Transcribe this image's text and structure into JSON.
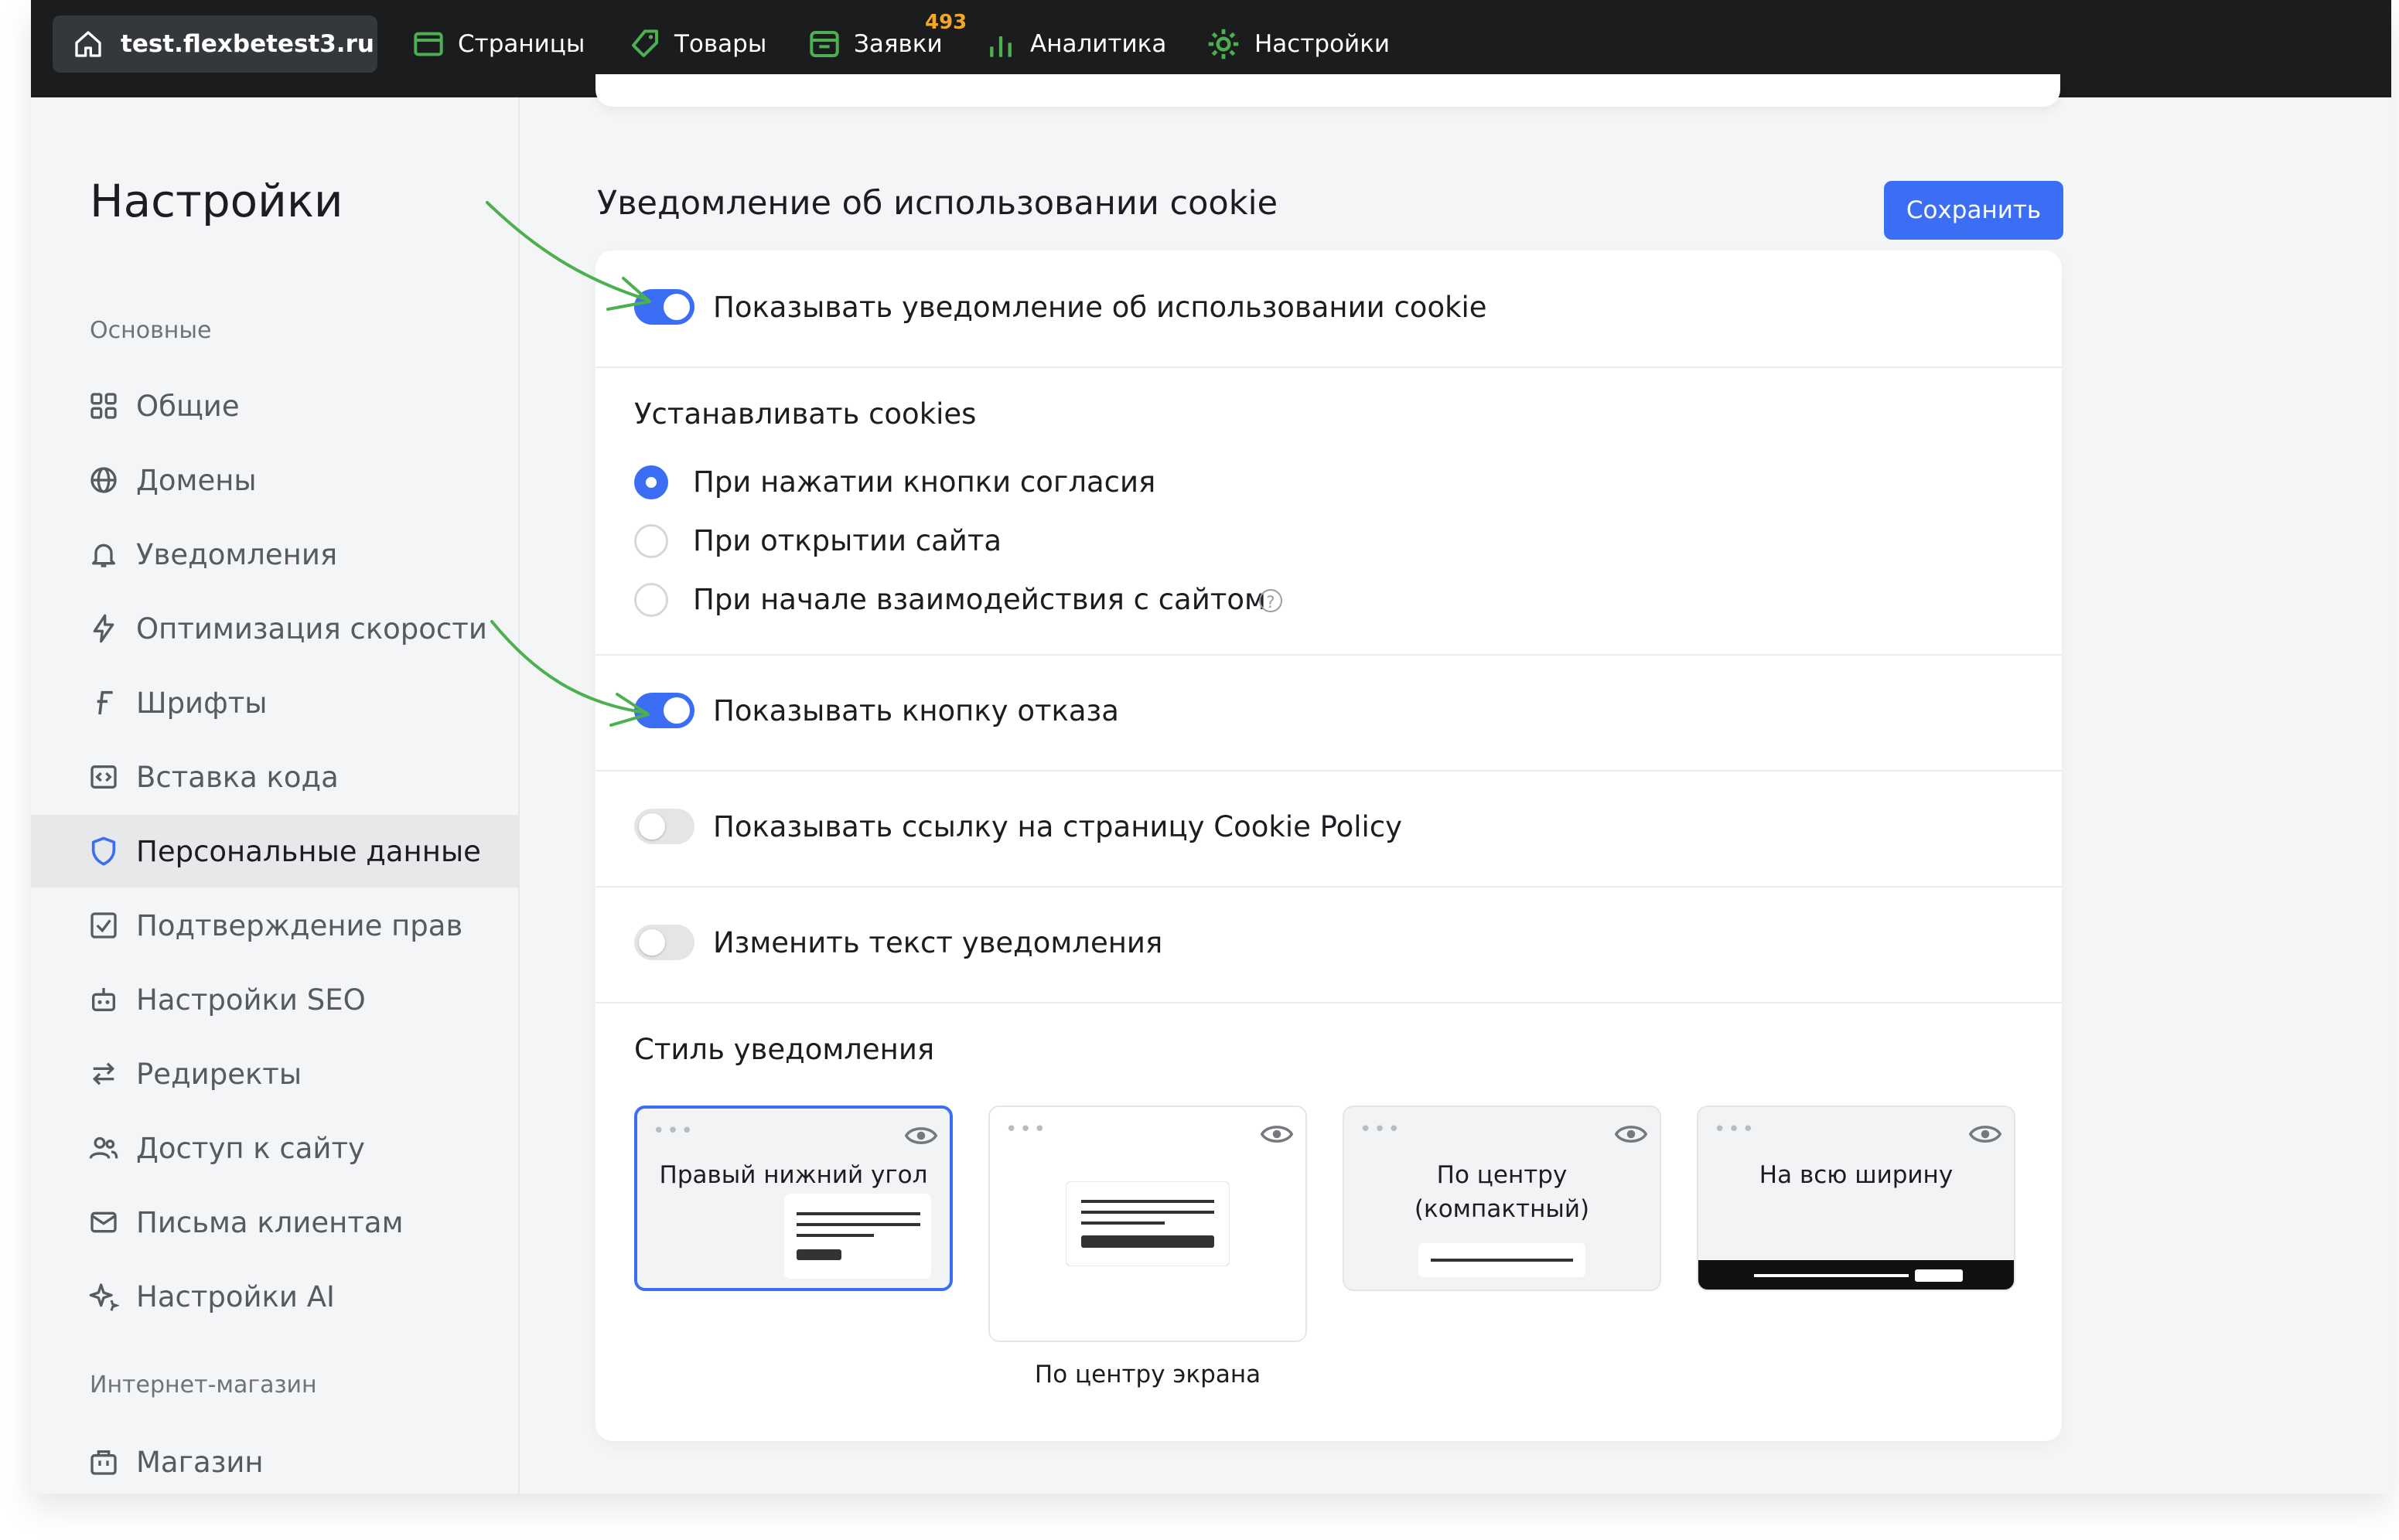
{
  "topbar": {
    "site": "test.flexbetest3.ru",
    "nav": [
      {
        "label": "Страницы",
        "icon": "pages-icon"
      },
      {
        "label": "Товары",
        "icon": "tag-icon"
      },
      {
        "label": "Заявки",
        "icon": "inbox-icon",
        "badge": "493"
      },
      {
        "label": "Аналитика",
        "icon": "chart-icon"
      },
      {
        "label": "Настройки",
        "icon": "gear-icon"
      }
    ]
  },
  "sidebar": {
    "title": "Настройки",
    "section_main": "Основные",
    "items": [
      {
        "label": "Общие",
        "icon": "grid-icon"
      },
      {
        "label": "Домены",
        "icon": "globe-icon"
      },
      {
        "label": "Уведомления",
        "icon": "bell-icon"
      },
      {
        "label": "Оптимизация скорости",
        "icon": "lightning-icon"
      },
      {
        "label": "Шрифты",
        "icon": "font-icon"
      },
      {
        "label": "Вставка кода",
        "icon": "code-icon"
      },
      {
        "label": "Персональные данные",
        "icon": "shield-icon",
        "active": true
      },
      {
        "label": "Подтверждение прав",
        "icon": "checkbox-icon"
      },
      {
        "label": "Настройки SEO",
        "icon": "robot-icon"
      },
      {
        "label": "Редиректы",
        "icon": "arrows-icon"
      },
      {
        "label": "Доступ к сайту",
        "icon": "users-icon"
      },
      {
        "label": "Письма клиентам",
        "icon": "mail-icon"
      },
      {
        "label": "Настройки AI",
        "icon": "sparkle-icon"
      }
    ],
    "section_shop": "Интернет-магазин",
    "shop_items": [
      {
        "label": "Магазин",
        "icon": "bag-icon"
      }
    ]
  },
  "main": {
    "title": "Уведомление об использовании cookie",
    "save_label": "Сохранить",
    "toggle_show_notice": {
      "label": "Показывать уведомление об использовании cookie",
      "on": true
    },
    "set_cookies": {
      "title": "Устанавливать cookies",
      "options": [
        {
          "label": "При нажатии кнопки согласия",
          "checked": true
        },
        {
          "label": "При открытии сайта",
          "checked": false
        },
        {
          "label": "При начале взаимодействия с сайтом",
          "checked": false,
          "help": "?"
        }
      ]
    },
    "toggle_reject": {
      "label": "Показывать кнопку отказа",
      "on": true
    },
    "toggle_policy": {
      "label": "Показывать ссылку на страницу Cookie Policy",
      "on": false
    },
    "toggle_text": {
      "label": "Изменить текст уведомления",
      "on": false
    },
    "style": {
      "title": "Стиль уведомления",
      "options": [
        {
          "label": "Правый нижний угол",
          "selected": true
        },
        {
          "label": "По центру экрана",
          "selected": false
        },
        {
          "label_line1": "По центру",
          "label_line2": "(компактный)",
          "selected": false
        },
        {
          "label": "На всю ширину",
          "selected": false
        }
      ]
    }
  },
  "colors": {
    "accent": "#3b6ef5",
    "topbar": "#1a1c1e",
    "badge": "#f5a623",
    "annotation_arrow": "#4caf50"
  }
}
